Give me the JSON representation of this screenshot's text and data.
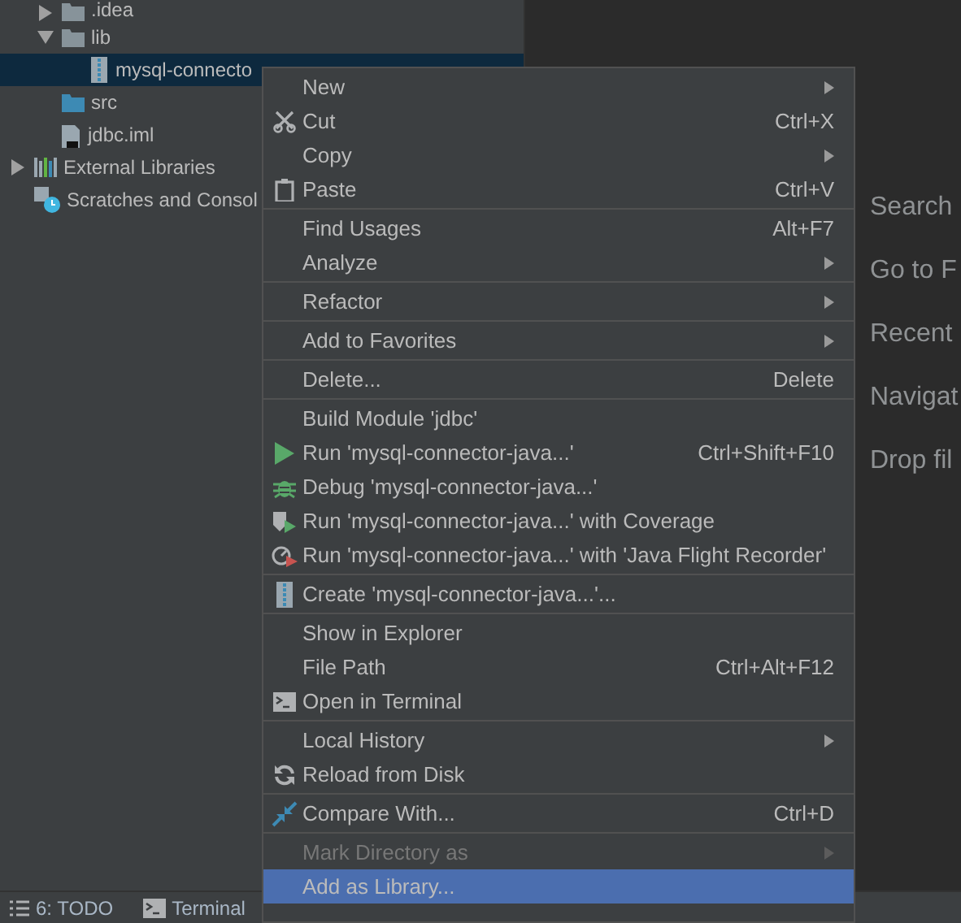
{
  "project_tree": {
    "items": [
      {
        "children": [
          {
            "label": ".idea",
            "kind": "folder",
            "expanded": false,
            "selected": false
          },
          {
            "label": "lib",
            "kind": "folder",
            "expanded": true,
            "selected": false,
            "children": [
              {
                "label": "mysql-connecto",
                "kind": "jar",
                "selected": true
              }
            ]
          },
          {
            "label": "src",
            "kind": "source-folder",
            "selected": false
          },
          {
            "label": "jdbc.iml",
            "kind": "file",
            "selected": false
          }
        ]
      },
      {
        "label": "External Libraries",
        "kind": "libraries",
        "expanded": false,
        "selected": false
      },
      {
        "label": "Scratches and Consol",
        "kind": "scratches",
        "selected": false
      }
    ]
  },
  "editor_hints": [
    "Search",
    "Go to F",
    "Recent",
    "Navigat",
    "Drop fil"
  ],
  "context_menu": {
    "groups": [
      [
        {
          "label": "New",
          "kind": "plain",
          "submenu": true,
          "disabled": false,
          "selected": false
        },
        {
          "label": "Cut",
          "kind": "scissors",
          "shortcut": "Ctrl+X",
          "submenu": false,
          "disabled": false,
          "selected": false
        },
        {
          "label": "Copy",
          "kind": "plain",
          "submenu": true,
          "disabled": false,
          "selected": false
        },
        {
          "label": "Paste",
          "kind": "clipboard",
          "shortcut": "Ctrl+V",
          "submenu": false,
          "disabled": false,
          "selected": false
        }
      ],
      [
        {
          "label": "Find Usages",
          "kind": "plain",
          "shortcut": "Alt+F7",
          "submenu": false,
          "disabled": false,
          "selected": false
        },
        {
          "label": "Analyze",
          "kind": "plain",
          "submenu": true,
          "disabled": false,
          "selected": false
        }
      ],
      [
        {
          "label": "Refactor",
          "kind": "plain",
          "submenu": true,
          "disabled": false,
          "selected": false
        }
      ],
      [
        {
          "label": "Add to Favorites",
          "kind": "plain",
          "submenu": true,
          "disabled": false,
          "selected": false
        }
      ],
      [
        {
          "label": "Delete...",
          "kind": "plain",
          "shortcut": "Delete",
          "submenu": false,
          "disabled": false,
          "selected": false
        }
      ],
      [
        {
          "label": "Build Module 'jdbc'",
          "kind": "plain",
          "submenu": false,
          "disabled": false,
          "selected": false
        },
        {
          "label": "Run 'mysql-connector-java...'",
          "kind": "run",
          "shortcut": "Ctrl+Shift+F10",
          "submenu": false,
          "disabled": false,
          "selected": false
        },
        {
          "label": "Debug 'mysql-connector-java...'",
          "kind": "bug",
          "submenu": false,
          "disabled": false,
          "selected": false
        },
        {
          "label": "Run 'mysql-connector-java...' with Coverage",
          "kind": "coverage",
          "submenu": false,
          "disabled": false,
          "selected": false
        },
        {
          "label": "Run 'mysql-connector-java...' with 'Java Flight Recorder'",
          "kind": "recorder",
          "submenu": false,
          "disabled": false,
          "selected": false
        }
      ],
      [
        {
          "label": "Create 'mysql-connector-java...'...",
          "kind": "jar",
          "submenu": false,
          "disabled": false,
          "selected": false
        }
      ],
      [
        {
          "label": "Show in Explorer",
          "kind": "plain",
          "submenu": false,
          "disabled": false,
          "selected": false
        },
        {
          "label": "File Path",
          "kind": "plain",
          "shortcut": "Ctrl+Alt+F12",
          "submenu": false,
          "disabled": false,
          "selected": false
        },
        {
          "label": "Open in Terminal",
          "kind": "terminal",
          "submenu": false,
          "disabled": false,
          "selected": false
        }
      ],
      [
        {
          "label": "Local History",
          "kind": "plain",
          "submenu": true,
          "disabled": false,
          "selected": false
        },
        {
          "label": "Reload from Disk",
          "kind": "reload",
          "submenu": false,
          "disabled": false,
          "selected": false
        }
      ],
      [
        {
          "label": "Compare With...",
          "kind": "compare",
          "shortcut": "Ctrl+D",
          "submenu": false,
          "disabled": false,
          "selected": false
        }
      ],
      [
        {
          "label": "Mark Directory as",
          "kind": "plain",
          "submenu": true,
          "disabled": true,
          "selected": false
        },
        {
          "label": "Add as Library...",
          "kind": "plain",
          "submenu": false,
          "disabled": false,
          "selected": true
        }
      ]
    ]
  },
  "bottom_bar": {
    "tabs": [
      {
        "label": "6: TODO",
        "kind": "list"
      },
      {
        "label": "Terminal",
        "kind": "terminal"
      }
    ]
  }
}
